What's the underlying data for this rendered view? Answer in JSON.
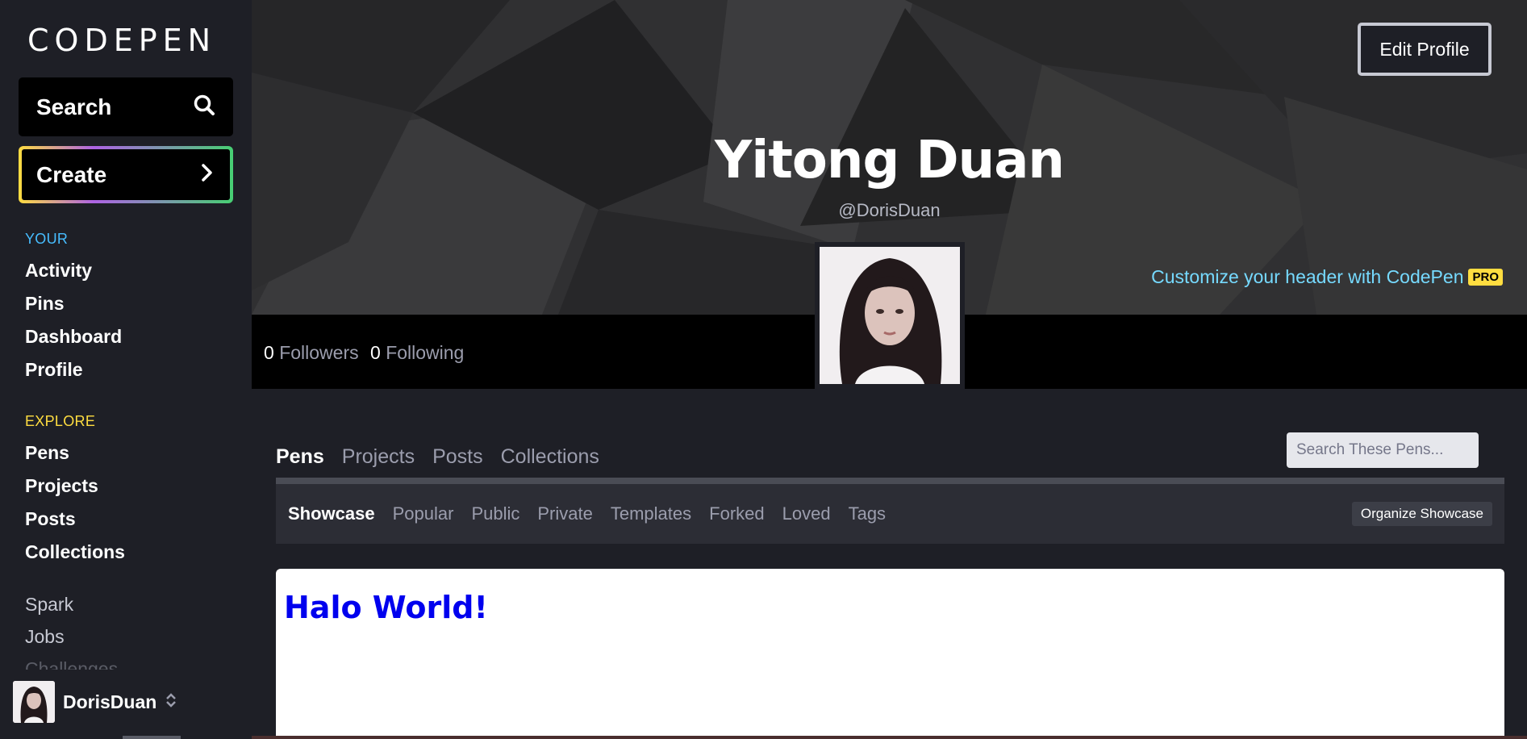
{
  "brand": {
    "logo": "CODEPEN"
  },
  "sidebar": {
    "search_label": "Search",
    "create_label": "Create",
    "your_label": "YOUR",
    "your_items": [
      {
        "label": "Activity"
      },
      {
        "label": "Pins"
      },
      {
        "label": "Dashboard"
      },
      {
        "label": "Profile"
      }
    ],
    "explore_label": "EXPLORE",
    "explore_items": [
      {
        "label": "Pens"
      },
      {
        "label": "Projects"
      },
      {
        "label": "Posts"
      },
      {
        "label": "Collections"
      }
    ],
    "extra_items": [
      {
        "label": "Spark"
      },
      {
        "label": "Jobs"
      },
      {
        "label": "Challenges"
      }
    ],
    "user": {
      "name": "DorisDuan"
    }
  },
  "header": {
    "edit_profile": "Edit Profile",
    "name": "Yitong Duan",
    "handle": "@DorisDuan",
    "customize": "Customize your header with CodePen",
    "pro_badge": "PRO"
  },
  "stats": {
    "followers_count": "0",
    "followers_label": "Followers",
    "following_count": "0",
    "following_label": "Following"
  },
  "content": {
    "tabs": [
      {
        "label": "Pens",
        "active": true
      },
      {
        "label": "Projects"
      },
      {
        "label": "Posts"
      },
      {
        "label": "Collections"
      }
    ],
    "search_placeholder": "Search These Pens...",
    "subtabs": [
      {
        "label": "Showcase",
        "active": true
      },
      {
        "label": "Popular"
      },
      {
        "label": "Public"
      },
      {
        "label": "Private"
      },
      {
        "label": "Templates"
      },
      {
        "label": "Forked"
      },
      {
        "label": "Loved"
      },
      {
        "label": "Tags"
      }
    ],
    "organize_label": "Organize Showcase",
    "pen_preview_text": "Halo World!"
  },
  "colors": {
    "your_accent": "#47bdff",
    "explore_accent": "#ffdd40",
    "customize_link": "#76daff",
    "pen_text": "#0000ee"
  }
}
